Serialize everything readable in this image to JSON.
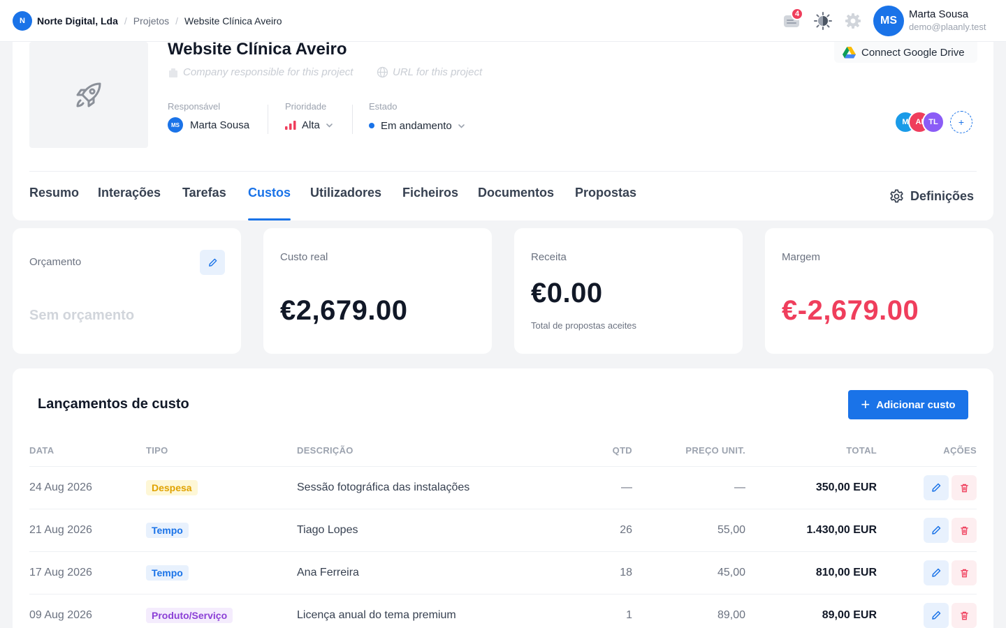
{
  "breadcrumb": {
    "org_initial": "N",
    "org": "Norte Digital, Lda",
    "section": "Projetos",
    "current": "Website Clínica Aveiro"
  },
  "topbar": {
    "notifications_count": "4",
    "user_initials": "MS",
    "user_name": "Marta Sousa",
    "user_email": "demo@plaanly.test"
  },
  "project": {
    "title": "Website Clínica Aveiro",
    "company_placeholder": "Company responsible for this project",
    "url_placeholder": "URL for this project",
    "gdrive_label": "Connect Google Drive",
    "responsavel_label": "Responsável",
    "responsavel_initials": "MS",
    "responsavel_name": "Marta Sousa",
    "prioridade_label": "Prioridade",
    "prioridade_value": "Alta",
    "estado_label": "Estado",
    "estado_value": "Em andamento",
    "team": [
      {
        "initials": "M",
        "color": "#1a9be8"
      },
      {
        "initials": "AI",
        "color": "#ef3e5c"
      },
      {
        "initials": "TL",
        "color": "#8b5cf6"
      }
    ],
    "add_member": "+"
  },
  "tabs": [
    {
      "label": "Resumo",
      "active": false
    },
    {
      "label": "Interações",
      "active": false
    },
    {
      "label": "Tarefas",
      "active": false
    },
    {
      "label": "Custos",
      "active": true
    },
    {
      "label": "Utilizadores",
      "active": false
    },
    {
      "label": "Ficheiros",
      "active": false
    },
    {
      "label": "Documentos",
      "active": false
    },
    {
      "label": "Propostas",
      "active": false
    }
  ],
  "settings_label": "Definições",
  "stats": {
    "orcamento_label": "Orçamento",
    "orcamento_value": "Sem orçamento",
    "custo_label": "Custo real",
    "custo_value": "€2,679.00",
    "receita_label": "Receita",
    "receita_value": "€0.00",
    "receita_sub": "Total de propostas aceites",
    "margem_label": "Margem",
    "margem_value": "€-2,679.00",
    "margem_color": "#ef3e5c"
  },
  "costs": {
    "title": "Lançamentos de custo",
    "add_label": "Adicionar custo",
    "headers": [
      "DATA",
      "TIPO",
      "DESCRIÇÃO",
      "QTD",
      "PREÇO UNIT.",
      "TOTAL",
      "AÇÕES"
    ],
    "rows": [
      {
        "date": "24 Aug 2026",
        "type": "Despesa",
        "desc": "Sessão fotográfica das instalações",
        "qty": "—",
        "unit": "—",
        "total": "350,00 EUR"
      },
      {
        "date": "21 Aug 2026",
        "type": "Tempo",
        "desc": "Tiago Lopes",
        "qty": "26",
        "unit": "55,00",
        "total": "1.430,00 EUR"
      },
      {
        "date": "17 Aug 2026",
        "type": "Tempo",
        "desc": "Ana Ferreira",
        "qty": "18",
        "unit": "45,00",
        "total": "810,00 EUR"
      },
      {
        "date": "09 Aug 2026",
        "type": "Produto/Serviço",
        "desc": "Licença anual do tema premium",
        "qty": "1",
        "unit": "89,00",
        "total": "89,00 EUR"
      }
    ]
  }
}
